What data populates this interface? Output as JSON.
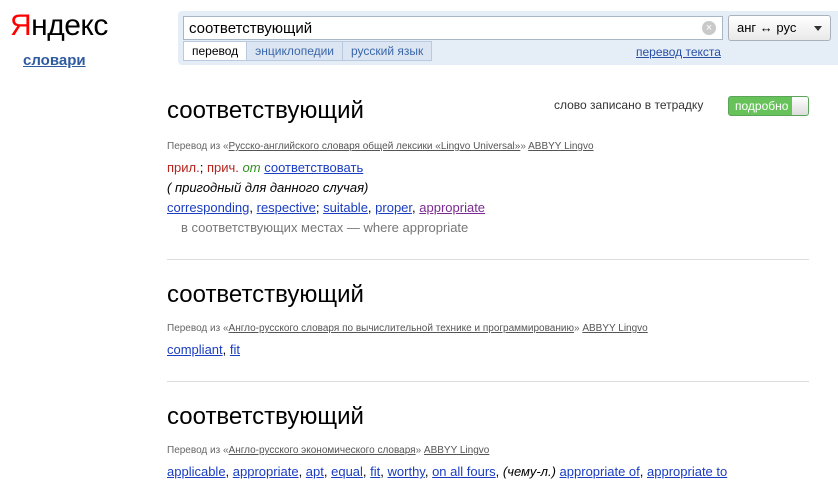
{
  "logo": {
    "first": "Я",
    "rest": "ндекс"
  },
  "service_link": "словари",
  "search": {
    "query": "соответствующий",
    "lang_pair": "анг ↔ рус",
    "tabs": [
      "перевод",
      "энциклопедии",
      "русский язык"
    ],
    "text_translate": "перевод текста"
  },
  "notebook": {
    "label": "слово записано в тетрадку",
    "toggle": "подробно"
  },
  "entries": [
    {
      "title": "соответствующий",
      "source_prefix": "Перевод из «",
      "source_dict": "Русско-английского словаря общей лексики «Lingvo Universal»",
      "source_mid": "» ",
      "source_brand": "ABBYY Lingvo",
      "pos1": "прил.",
      "pos_sep": "; ",
      "pos2": "прич.",
      "from_word": "от",
      "base_word": "соответствовать",
      "comment": "( пригодный для данного случая)",
      "translations": [
        "corresponding",
        "respective",
        "suitable",
        "proper",
        "appropriate"
      ],
      "example": "в соответствующих местах — where appropriate"
    },
    {
      "title": "соответствующий",
      "source_prefix": "Перевод из «",
      "source_dict": "Англо-русского словаря по вычислительной технике и программированию",
      "source_mid": "» ",
      "source_brand": "ABBYY Lingvo",
      "translations": [
        "compliant",
        "fit"
      ]
    },
    {
      "title": "соответствующий",
      "source_prefix": "Перевод из «",
      "source_dict": "Англо-русского экономического словаря",
      "source_mid": "» ",
      "source_brand": "ABBYY Lingvo",
      "translations": [
        "applicable",
        "appropriate",
        "apt",
        "equal",
        "fit",
        "worthy",
        "on all fours"
      ],
      "note": "(чему-л.)",
      "translations_after": [
        "appropriate of",
        "appropriate to"
      ]
    }
  ],
  "colors": {
    "logo_red": "#ff0000",
    "link": "#1a3dc1",
    "pos": "#b6251e",
    "toggle_green": "#67c25a"
  }
}
